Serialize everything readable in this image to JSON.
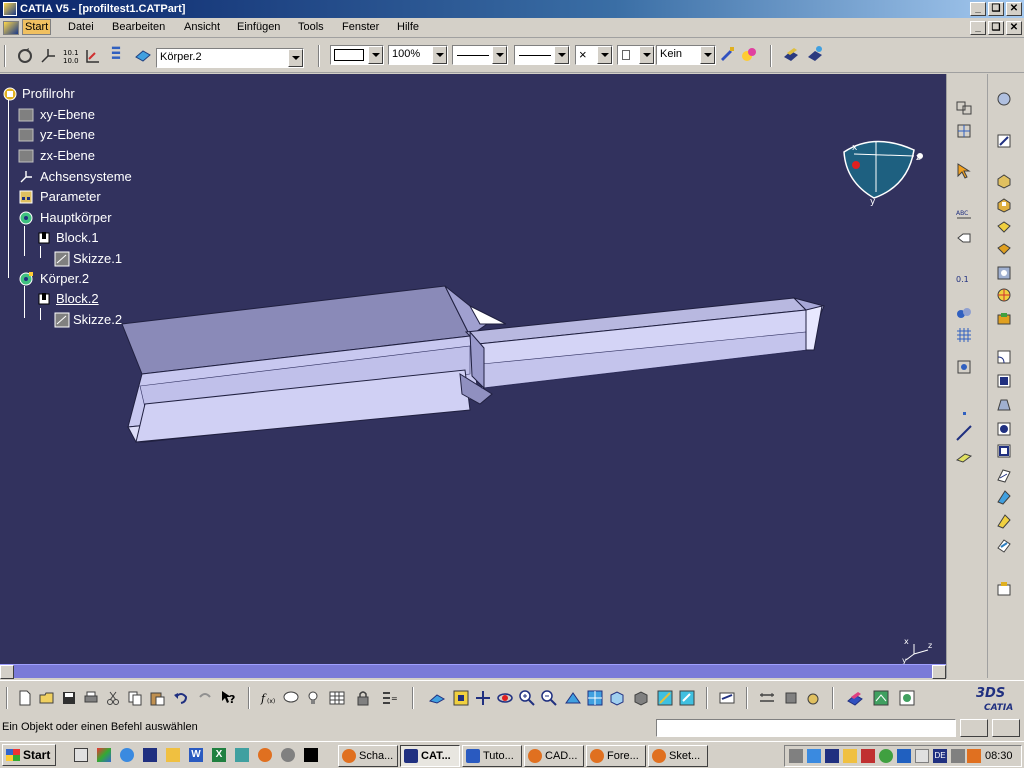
{
  "window": {
    "title": "CATIA V5 - [profiltest1.CATPart]",
    "controls": [
      "_",
      "❑",
      "✕"
    ]
  },
  "menubar": {
    "items": [
      "Start",
      "Datei",
      "Bearbeiten",
      "Ansicht",
      "Einfügen",
      "Tools",
      "Fenster",
      "Hilfe"
    ]
  },
  "toolbar": {
    "body_select": "Körper.2",
    "zoom": "100%",
    "layer": "Kein"
  },
  "tree": {
    "root": "Profilrohr",
    "nodes": [
      "xy-Ebene",
      "yz-Ebene",
      "zx-Ebene",
      "Achsensysteme",
      "Parameter",
      "Hauptkörper",
      "Block.1",
      "Skizze.1",
      "Körper.2",
      "Block.2",
      "Skizze.2"
    ]
  },
  "compass": {
    "x_label": "x",
    "y_label": "y",
    "z_label": "z"
  },
  "axis_triad": {
    "x_label": "x",
    "y_label": "y",
    "z_label": "z"
  },
  "brand": {
    "logo_text": "CATIA",
    "logo_mark": "3DS"
  },
  "statusbar": {
    "message": "Ein Objekt oder einen Befehl auswählen",
    "command_value": ""
  },
  "taskbar": {
    "start_label": "Start",
    "tasks": [
      "Scha...",
      "CAT...",
      "Tuto...",
      "CAD...",
      "Fore...",
      "Sket..."
    ],
    "lang": "DE",
    "clock": "08:30"
  },
  "colors": {
    "viewport_bg": "#32325e",
    "titlebar": "#0a246a",
    "model_face": "#c8c8f0"
  }
}
